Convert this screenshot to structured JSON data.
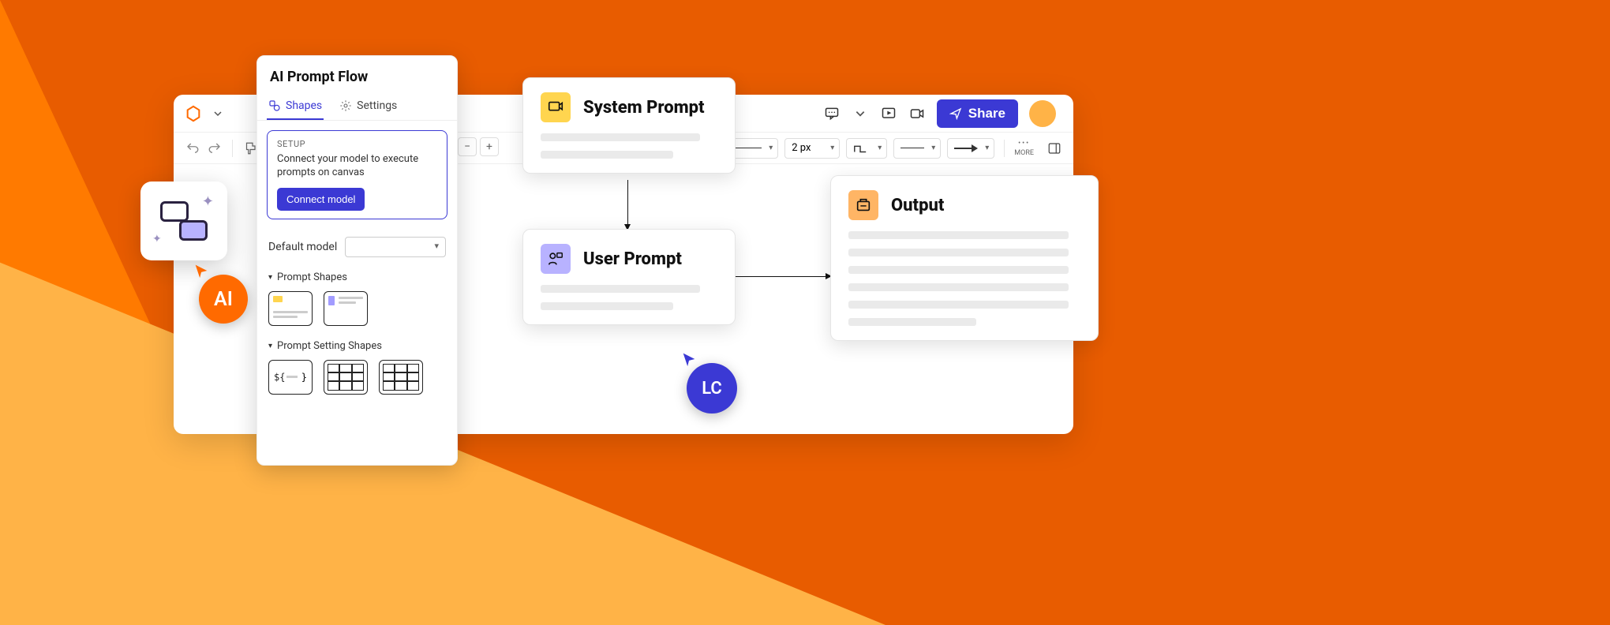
{
  "topbar": {
    "share_label": "Share"
  },
  "toolbar": {
    "stroke_width": "2 px",
    "more_label": "MORE"
  },
  "panel": {
    "title": "AI Prompt Flow",
    "tabs": {
      "shapes": "Shapes",
      "settings": "Settings"
    },
    "setup": {
      "badge": "SETUP",
      "text": "Connect your model to execute prompts on canvas",
      "button": "Connect model"
    },
    "default_model_label": "Default model",
    "sections": {
      "prompt_shapes": "Prompt Shapes",
      "setting_shapes": "Prompt Setting Shapes",
      "var_shape_label": "${"
    }
  },
  "cards": {
    "system": {
      "title": "System Prompt"
    },
    "user": {
      "title": "User Prompt"
    },
    "output": {
      "title": "Output"
    }
  },
  "cursors": {
    "ai": "AI",
    "lc": "LC"
  }
}
